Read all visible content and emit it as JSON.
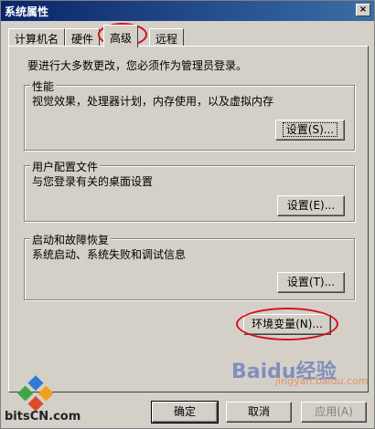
{
  "window": {
    "title": "系统属性",
    "close_glyph": "×"
  },
  "tabs": [
    {
      "label": "计算机名"
    },
    {
      "label": "硬件"
    },
    {
      "label": "高级",
      "active": true
    },
    {
      "label": "远程"
    }
  ],
  "intro": "要进行大多数更改，您必须作为管理员登录。",
  "groups": {
    "performance": {
      "title": "性能",
      "desc": "视觉效果，处理器计划，内存使用，以及虚拟内存",
      "button": "设置(S)..."
    },
    "user_profiles": {
      "title": "用户配置文件",
      "desc": "与您登录有关的桌面设置",
      "button": "设置(E)..."
    },
    "startup_recovery": {
      "title": "启动和故障恢复",
      "desc": "系统启动、系统失败和调试信息",
      "button": "设置(T)..."
    }
  },
  "env_button": "环境变量(N)...",
  "footer": {
    "ok": "确定",
    "cancel": "取消",
    "apply": "应用(A)"
  },
  "branding": {
    "logo_text": "bitsCN.com",
    "watermark": "Baidu经验",
    "watermark_sub": "jingyan.baidu.com"
  },
  "colors": {
    "annotation_circle": "#d4101c",
    "titlebar": "#0a246a",
    "dialog_bg": "#d4d0c8"
  }
}
